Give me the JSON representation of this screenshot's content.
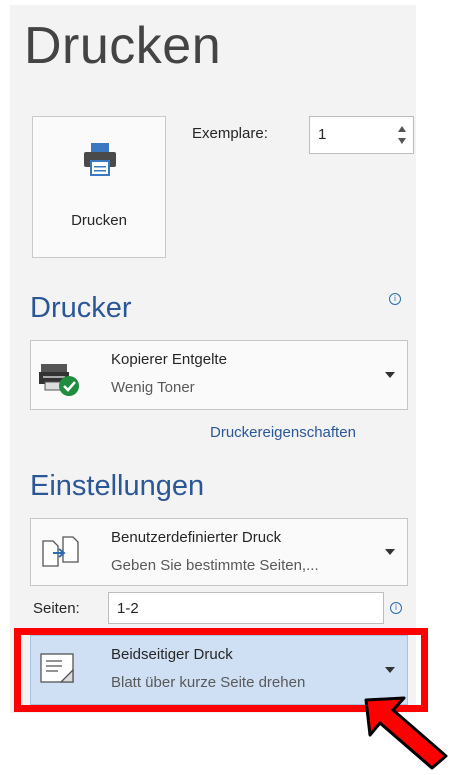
{
  "title": "Drucken",
  "print_button": {
    "label": "Drucken",
    "icon": "printer-icon"
  },
  "copies": {
    "label": "Exemplare:",
    "value": "1"
  },
  "printer_section": {
    "heading": "Drucker",
    "printer": {
      "name": "Kopierer Entgelte",
      "status": "Wenig Toner",
      "icon": "printer-ready-icon"
    },
    "properties_link": "Druckereigenschaften"
  },
  "settings_section": {
    "heading": "Einstellungen",
    "print_range": {
      "title": "Benutzerdefinierter Druck",
      "subtitle": "Geben Sie bestimmte Seiten,..."
    },
    "pages": {
      "label": "Seiten:",
      "value": "1-2"
    },
    "duplex": {
      "title": "Beidseitiger Druck",
      "subtitle": "Blatt über kurze Seite drehen"
    }
  },
  "colors": {
    "accent": "#2b5797",
    "highlight": "#ff0000",
    "selected_bg": "#cfe0f4"
  }
}
